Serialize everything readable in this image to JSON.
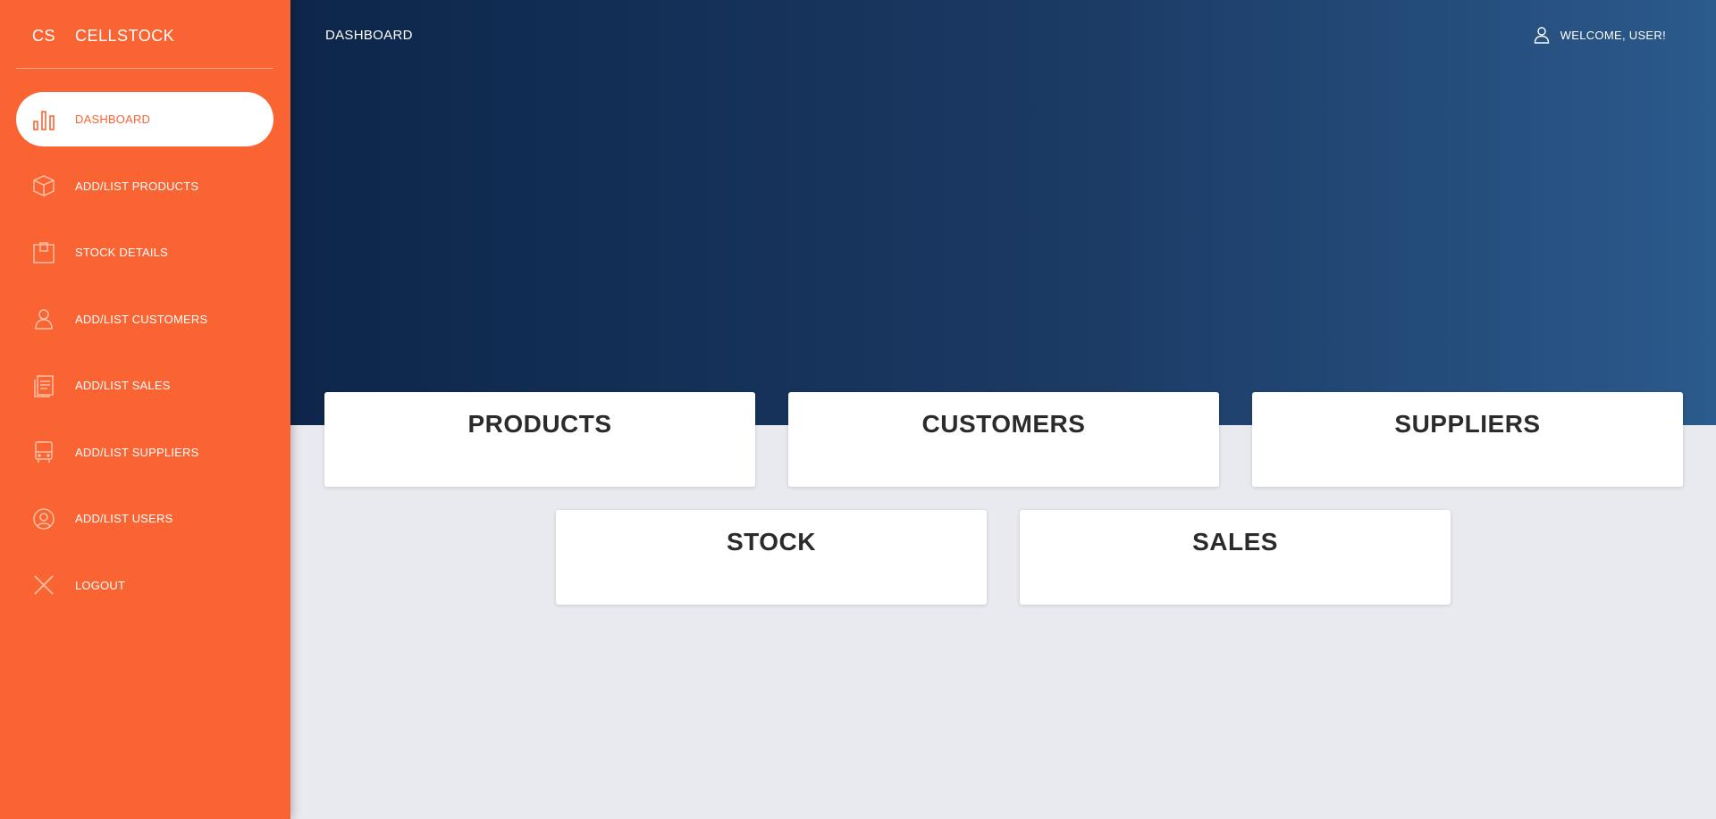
{
  "brand": {
    "mini": "CS",
    "name": "CELLSTOCK"
  },
  "colors": {
    "sidebar": "#fa6432",
    "hero_start": "#0d264a",
    "hero_end": "#2b5a8c",
    "background": "#e9eaef"
  },
  "sidebar": {
    "items": [
      {
        "label": "DASHBOARD",
        "icon": "bar-chart-icon",
        "active": true
      },
      {
        "label": "ADD/LIST PRODUCTS",
        "icon": "box-icon"
      },
      {
        "label": "STOCK DETAILS",
        "icon": "package-icon"
      },
      {
        "label": "ADD/LIST CUSTOMERS",
        "icon": "user-icon"
      },
      {
        "label": "ADD/LIST SALES",
        "icon": "receipt-icon"
      },
      {
        "label": "ADD/LIST SUPPLIERS",
        "icon": "truck-icon"
      },
      {
        "label": "ADD/LIST USERS",
        "icon": "user-circle-icon"
      },
      {
        "label": "LOGOUT",
        "icon": "close-icon"
      }
    ]
  },
  "header": {
    "title": "DASHBOARD",
    "welcome": "WELCOME, USER!",
    "user_icon": "user-icon"
  },
  "cards": {
    "products": "PRODUCTS",
    "customers": "CUSTOMERS",
    "suppliers": "SUPPLIERS",
    "stock": "STOCK",
    "sales": "SALES"
  }
}
